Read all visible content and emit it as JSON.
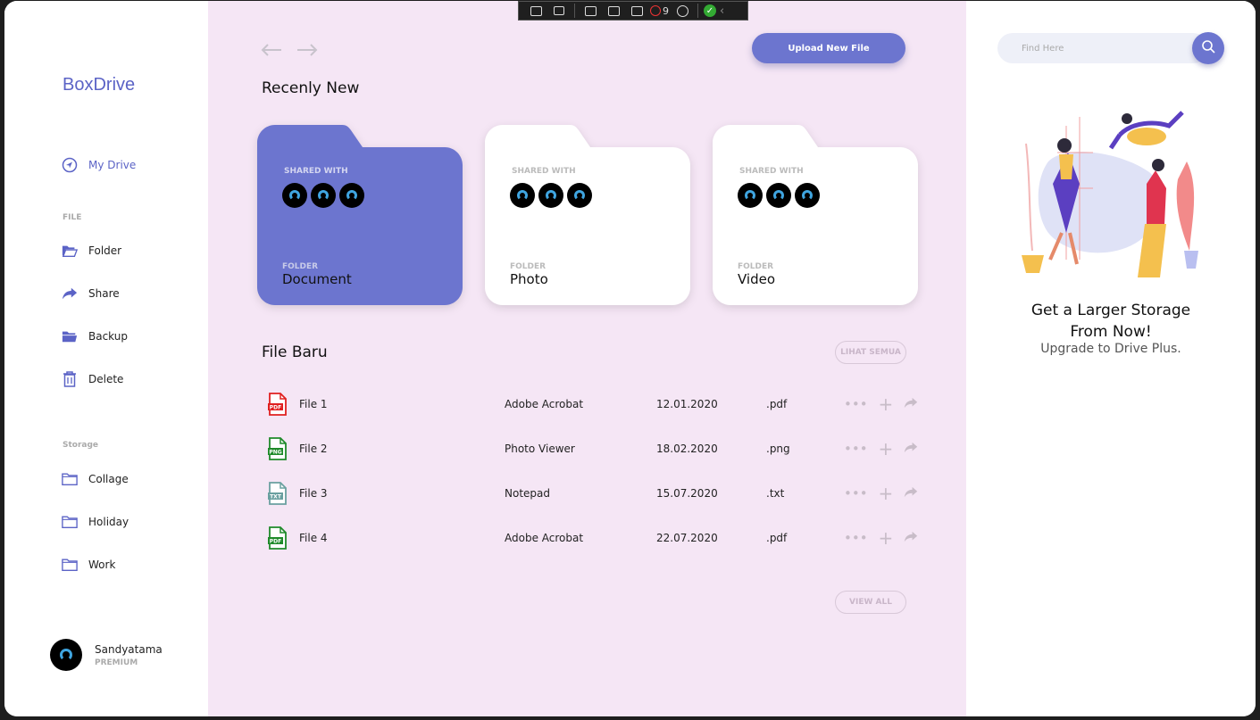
{
  "app": {
    "logo": "BoxDrive",
    "accent": "#6c75cf",
    "main_bg": "#f5e6f5"
  },
  "debug_toolbar": {
    "badge_count": "9"
  },
  "sidebar": {
    "my_drive": "My Drive",
    "file_label": "FILE",
    "file_items": [
      {
        "label": "Folder",
        "icon": "folder-open-icon"
      },
      {
        "label": "Share",
        "icon": "share-arrow-icon"
      },
      {
        "label": "Backup",
        "icon": "folder-filled-icon"
      },
      {
        "label": "Delete",
        "icon": "trash-icon"
      }
    ],
    "storage_label": "Storage",
    "storage_items": [
      {
        "label": "Collage",
        "icon": "folder-icon"
      },
      {
        "label": "Holiday",
        "icon": "folder-icon"
      },
      {
        "label": "Work",
        "icon": "folder-icon"
      }
    ],
    "user": {
      "name": "Sandyatama",
      "tier": "PREMIUM"
    }
  },
  "main": {
    "upload_label": "Upload New File",
    "recent_title": "Recenly New",
    "folders": [
      {
        "shared_label": "SHARED WITH",
        "folder_label": "FOLDER",
        "name": "Document",
        "style": "blue"
      },
      {
        "shared_label": "SHARED WITH",
        "folder_label": "FOLDER",
        "name": "Photo",
        "style": "white"
      },
      {
        "shared_label": "SHARED WITH",
        "folder_label": "FOLDER",
        "name": "Video",
        "style": "white"
      }
    ],
    "file_title": "File Baru",
    "see_all": "LIHAT SEMUA",
    "files": [
      {
        "name": "File 1",
        "app": "Adobe Acrobat",
        "date": "12.01.2020",
        "ext": ".pdf",
        "icon": "pdf-file-icon",
        "color": "#e02020",
        "tag": "PDF"
      },
      {
        "name": "File 2",
        "app": "Photo Viewer",
        "date": "18.02.2020",
        "ext": ".png",
        "icon": "png-file-icon",
        "color": "#1f8a2a",
        "tag": "PNG"
      },
      {
        "name": "File 3",
        "app": "Notepad",
        "date": "15.07.2020",
        "ext": ".txt",
        "icon": "txt-file-icon",
        "color": "#6aa0a0",
        "tag": "TXT"
      },
      {
        "name": "File 4",
        "app": "Adobe Acrobat",
        "date": "22.07.2020",
        "ext": ".pdf",
        "icon": "pdf-file-icon",
        "color": "#1f8a2a",
        "tag": "PDF"
      }
    ],
    "view_all": "VIEW ALL"
  },
  "right": {
    "search_placeholder": "Find Here",
    "promo_title": "Get a Larger Storage\nFrom Now!",
    "promo_sub": "Upgrade to Drive Plus."
  }
}
